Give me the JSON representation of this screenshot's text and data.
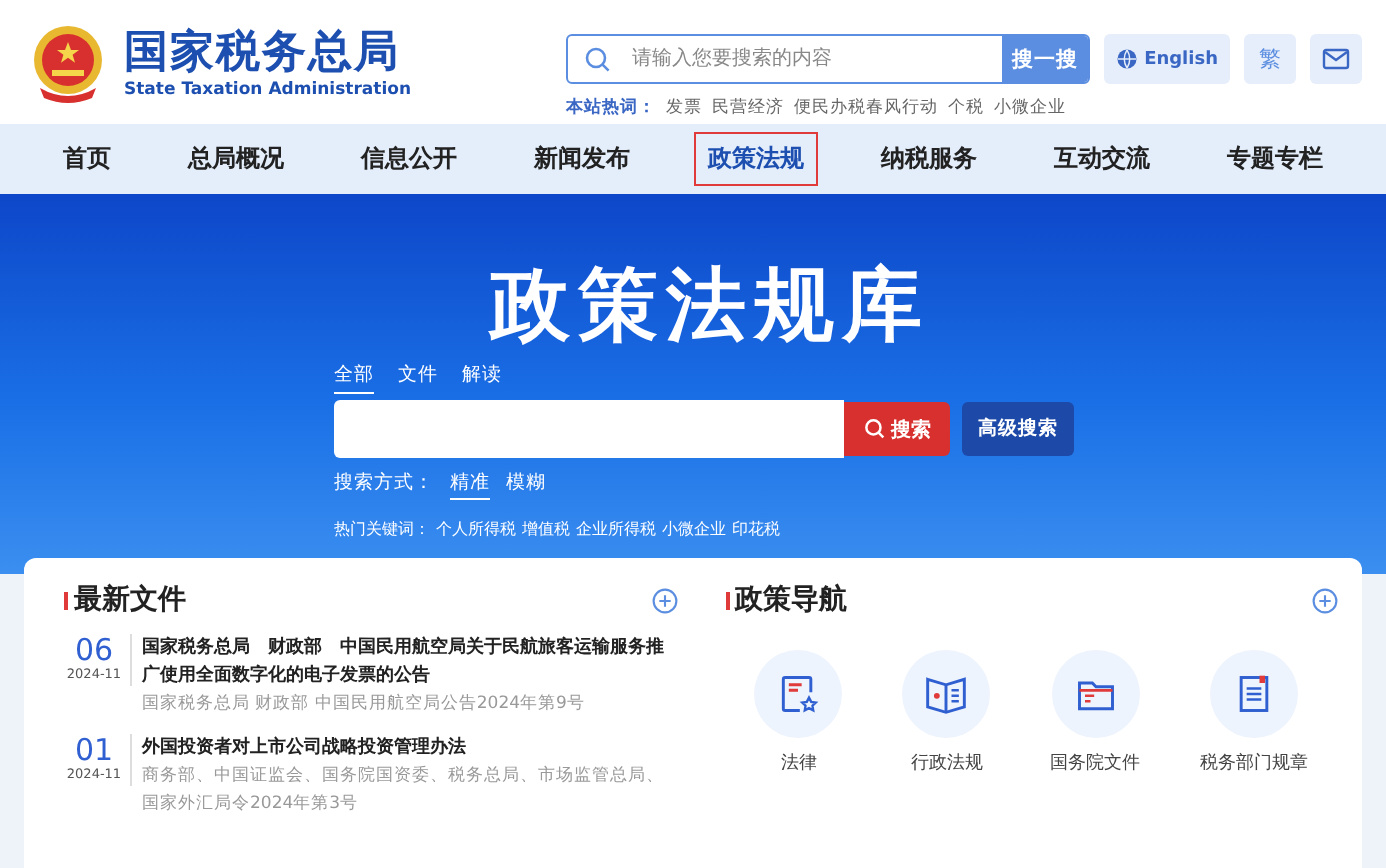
{
  "header": {
    "title": "国家税务总局",
    "subtitle": "State Taxation Administration",
    "search": {
      "placeholder": "请输入您要搜索的内容",
      "button": "搜一搜"
    },
    "english": "English",
    "traditional": "繁",
    "hot_label": "本站热词：",
    "hot_words": [
      "发票",
      "民营经济",
      "便民办税春风行动",
      "个税",
      "小微企业"
    ]
  },
  "nav": [
    {
      "label": "首页",
      "selected": false
    },
    {
      "label": "总局概况",
      "selected": false
    },
    {
      "label": "信息公开",
      "selected": false
    },
    {
      "label": "新闻发布",
      "selected": false
    },
    {
      "label": "政策法规",
      "selected": true
    },
    {
      "label": "纳税服务",
      "selected": false
    },
    {
      "label": "互动交流",
      "selected": false
    },
    {
      "label": "专题专栏",
      "selected": false
    }
  ],
  "hero": {
    "title": "政策法规库",
    "scopes": [
      {
        "label": "全部",
        "selected": true
      },
      {
        "label": "文件",
        "selected": false
      },
      {
        "label": "解读",
        "selected": false
      }
    ],
    "search_button": "搜索",
    "advanced_button": "高级搜索",
    "mode_label": "搜索方式：",
    "modes": [
      {
        "label": "精准",
        "selected": true
      },
      {
        "label": "模糊",
        "selected": false
      }
    ],
    "keywords_label": "热门关键词：",
    "keywords": [
      "个人所得税",
      "增值税",
      "企业所得税",
      "小微企业",
      "印花税"
    ]
  },
  "latest": {
    "title": "最新文件",
    "items": [
      {
        "day": "06",
        "month": "2024-11",
        "title": "国家税务总局　财政部　中国民用航空局关于民航旅客运输服务推广使用全面数字化的电子发票的公告",
        "source": "国家税务总局 财政部 中国民用航空局公告2024年第9号"
      },
      {
        "day": "01",
        "month": "2024-11",
        "title": "外国投资者对上市公司战略投资管理办法",
        "source": "商务部、中国证监会、国务院国资委、税务总局、市场监管总局、国家外汇局令2024年第3号"
      }
    ]
  },
  "policy_nav": {
    "title": "政策导航",
    "items": [
      {
        "label": "法律",
        "kind": "law"
      },
      {
        "label": "行政法规",
        "kind": "regulation"
      },
      {
        "label": "国务院文件",
        "kind": "folder"
      },
      {
        "label": "税务部门规章",
        "kind": "rules"
      }
    ]
  }
}
